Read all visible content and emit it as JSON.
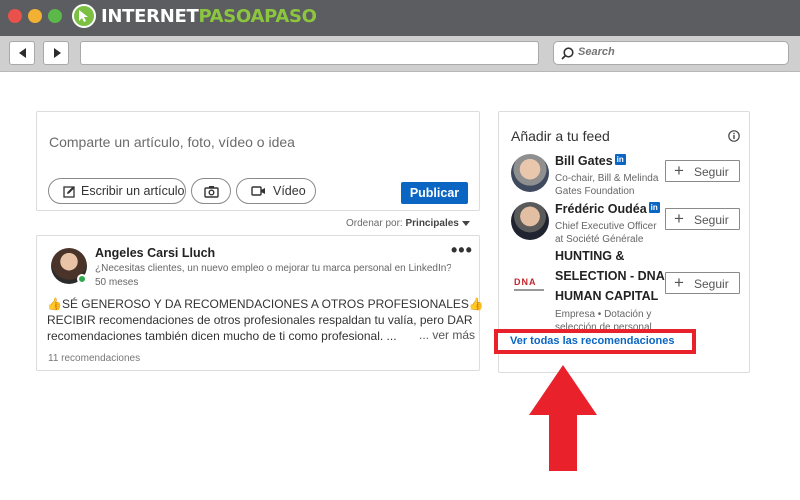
{
  "browser": {
    "logo": {
      "text_white": "INTERNET",
      "text_green": "PASOAPASO"
    },
    "search_placeholder": "Search"
  },
  "composer": {
    "prompt": "Comparte un artículo, foto, vídeo o idea",
    "write_article": "Escribir un artículo",
    "video": "Vídeo",
    "publish": "Publicar"
  },
  "sort": {
    "label": "Ordenar por:",
    "value": "Principales"
  },
  "post": {
    "author": "Angeles Carsi Lluch",
    "headline": "¿Necesitas clientes, un nuevo empleo o mejorar tu marca personal en LinkedIn?¬...",
    "age": "50 meses",
    "body_lines": [
      "👍SÉ GENEROSO Y DA RECOMENDACIONES A OTROS PROFESIONALES👍",
      "RECIBIR recomendaciones de otros profesionales respaldan tu valía, pero DAR",
      "recomendaciones también dicen mucho de ti como profesional. ..."
    ],
    "see_more": "... ver más",
    "recommendations_count": "11 recomendaciones"
  },
  "feed": {
    "title": "Añadir a tu feed",
    "follow_label": "Seguir",
    "recommendations": [
      {
        "name": "Bill Gates",
        "badge": "in",
        "subtitle": [
          "Co-chair, Bill & Melinda",
          "Gates Foundation"
        ]
      },
      {
        "name": "Frédéric Oudéa",
        "badge": "in",
        "subtitle": [
          "Chief Executive Officer",
          "at Société Générale"
        ]
      },
      {
        "name_lines": [
          "HUNTING &",
          "SELECTION - DNA",
          "HUMAN CAPITAL"
        ],
        "subtitle": [
          "Empresa • Dotación y",
          "selección de personal"
        ],
        "logo_text": "DNA"
      }
    ],
    "see_all": "Ver todas las recomendaciones"
  },
  "colors": {
    "linkedin_blue": "#0a66c2",
    "highlight_red": "#e8212a",
    "logo_green": "#8cc63f",
    "titlebar": "#5b5d60"
  }
}
